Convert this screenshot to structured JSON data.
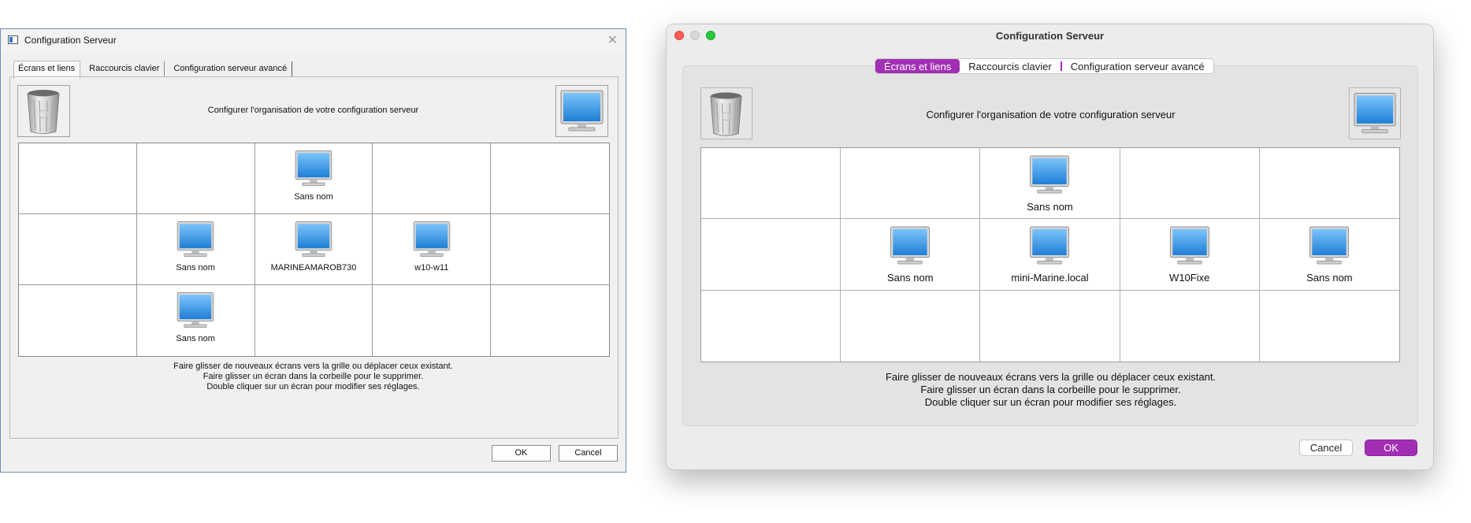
{
  "windows_dialog": {
    "title": "Configuration Serveur",
    "tabs": [
      {
        "label": "Écrans et liens",
        "active": true
      },
      {
        "label": "Raccourcis clavier",
        "active": false
      },
      {
        "label": "Configuration serveur avancé",
        "active": false
      }
    ],
    "instruction": "Configurer l'organisation de votre configuration serveur",
    "grid": [
      [
        "",
        "",
        "Sans nom",
        "",
        ""
      ],
      [
        "",
        "Sans nom",
        "MARINEAMAROB730",
        "w10-w11",
        ""
      ],
      [
        "",
        "Sans nom",
        "",
        "",
        ""
      ]
    ],
    "help_lines": [
      "Faire glisser de nouveaux écrans vers la grille ou déplacer ceux existant.",
      "Faire glisser un écran dans la corbeille pour le supprimer.",
      "Double cliquer sur un écran pour modifier ses réglages."
    ],
    "buttons": {
      "ok": "OK",
      "cancel": "Cancel"
    }
  },
  "mac_dialog": {
    "title": "Configuration Serveur",
    "tabs": [
      {
        "label": "Écrans et liens",
        "active": true
      },
      {
        "label": "Raccourcis clavier",
        "active": false
      },
      {
        "label": "Configuration serveur avancé",
        "active": false
      }
    ],
    "instruction": "Configurer l'organisation de votre configuration serveur",
    "grid": [
      [
        "",
        "",
        "Sans nom",
        "",
        ""
      ],
      [
        "",
        "Sans nom",
        "mini-Marine.local",
        "W10Fixe",
        "Sans nom"
      ],
      [
        "",
        "",
        "",
        "",
        ""
      ]
    ],
    "help_lines": [
      "Faire glisser de nouveaux écrans vers la grille ou déplacer ceux existant.",
      "Faire glisser un écran dans la corbeille pour le supprimer.",
      "Double cliquer sur un écran pour modifier ses réglages."
    ],
    "buttons": {
      "cancel": "Cancel",
      "ok": "OK"
    }
  },
  "colors": {
    "mac_accent": "#a12fb4",
    "monitor_screen": "#3f9be8"
  },
  "icons": [
    "trash-icon",
    "monitor-icon",
    "close-icon",
    "app-icon"
  ]
}
